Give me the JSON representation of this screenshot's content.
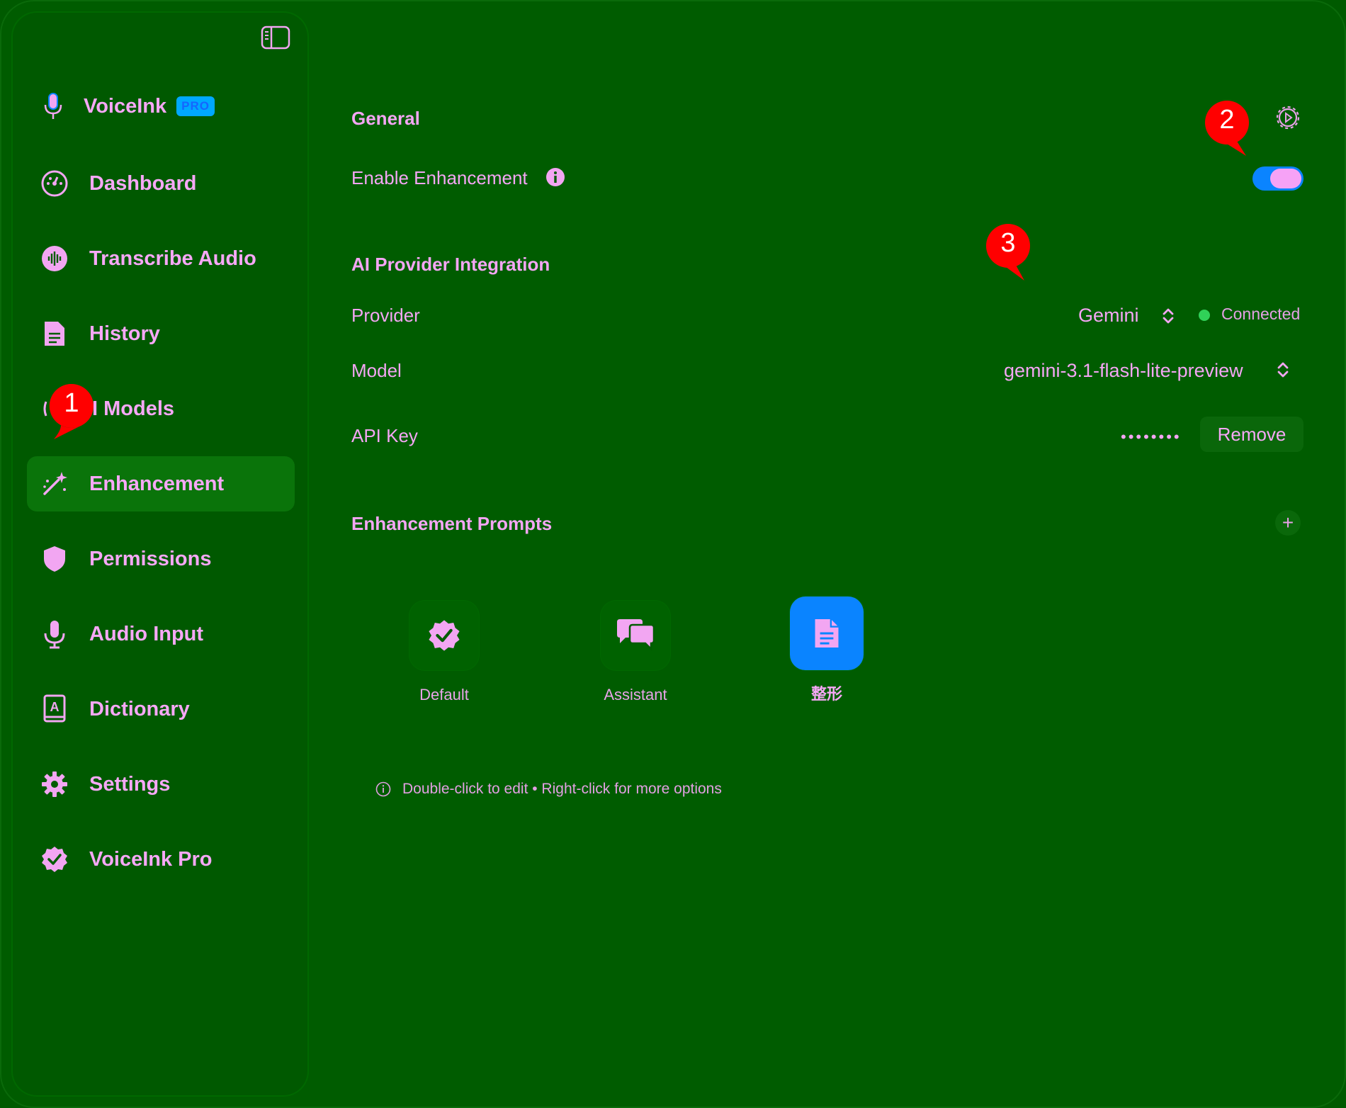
{
  "app": {
    "name": "VoiceInk",
    "badge": "PRO"
  },
  "sidebar": {
    "items": [
      {
        "label": "Dashboard",
        "icon": "gauge-icon"
      },
      {
        "label": "Transcribe Audio",
        "icon": "waveform-icon"
      },
      {
        "label": "History",
        "icon": "document-icon"
      },
      {
        "label": "AI Models",
        "icon": "brain-icon"
      },
      {
        "label": "Enhancement",
        "icon": "magic-wand-icon"
      },
      {
        "label": "Permissions",
        "icon": "shield-icon"
      },
      {
        "label": "Audio Input",
        "icon": "microphone-icon"
      },
      {
        "label": "Dictionary",
        "icon": "dictionary-icon"
      },
      {
        "label": "Settings",
        "icon": "gear-icon"
      },
      {
        "label": "VoiceInk Pro",
        "icon": "verified-badge-icon"
      }
    ],
    "active": "Enhancement",
    "ai_models_visible_label": "I Models"
  },
  "general": {
    "title": "General",
    "enable_label": "Enable Enhancement",
    "enabled": true
  },
  "provider": {
    "title": "AI Provider Integration",
    "provider_label": "Provider",
    "provider_value": "Gemini",
    "status": "Connected",
    "model_label": "Model",
    "model_value": "gemini-3.1-flash-lite-preview",
    "api_key_label": "API Key",
    "api_key_masked": "••••••••",
    "remove_label": "Remove"
  },
  "prompts": {
    "title": "Enhancement Prompts",
    "items": [
      {
        "label": "Default",
        "icon": "verified-badge-icon"
      },
      {
        "label": "Assistant",
        "icon": "chat-bubbles-icon"
      },
      {
        "label": "整形",
        "icon": "document-icon",
        "selected": true
      }
    ],
    "hint": "Double-click to edit • Right-click for more options"
  },
  "annotations": [
    "1",
    "2",
    "3"
  ],
  "colors": {
    "background": "#005c00",
    "accent": "#0a84ff",
    "text": "#f4a6f4",
    "status_green": "#30d158",
    "badge_red": "#ff0000"
  }
}
